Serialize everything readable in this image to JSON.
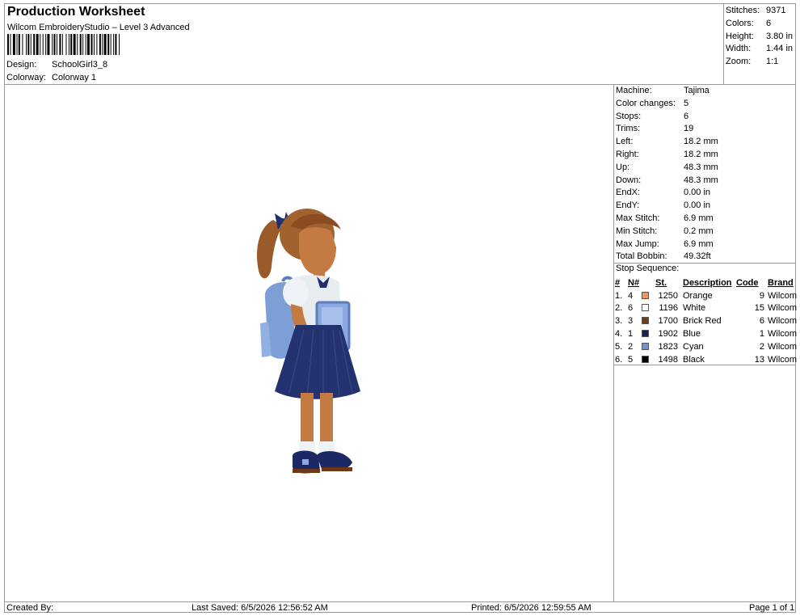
{
  "header": {
    "title": "Production Worksheet",
    "subtitle": "Wilcom EmbroideryStudio – Level 3 Advanced",
    "design_label": "Design:",
    "design_value": "SchoolGirl3_8",
    "colorway_label": "Colorway:",
    "colorway_value": "Colorway 1"
  },
  "summary": [
    {
      "label": "Stitches:",
      "value": "9371"
    },
    {
      "label": "Colors:",
      "value": "6"
    },
    {
      "label": "Height:",
      "value": "3.80 in"
    },
    {
      "label": "Width:",
      "value": "1.44 in"
    },
    {
      "label": "Zoom:",
      "value": "1:1"
    }
  ],
  "machine_info": [
    {
      "label": "Machine:",
      "value": "Tajima"
    },
    {
      "label": "Color changes:",
      "value": "5"
    },
    {
      "label": "Stops:",
      "value": "6"
    },
    {
      "label": "Trims:",
      "value": "19"
    },
    {
      "label": "Left:",
      "value": "18.2 mm"
    },
    {
      "label": "Right:",
      "value": "18.2 mm"
    },
    {
      "label": "Up:",
      "value": "48.3 mm"
    },
    {
      "label": "Down:",
      "value": "48.3 mm"
    },
    {
      "label": "EndX:",
      "value": "0.00 in"
    },
    {
      "label": "EndY:",
      "value": "0.00 in"
    },
    {
      "label": "Max Stitch:",
      "value": "6.9 mm"
    },
    {
      "label": "Min Stitch:",
      "value": "0.2 mm"
    },
    {
      "label": "Max Jump:",
      "value": "6.9 mm"
    },
    {
      "label": "Total Bobbin:",
      "value": "49.32ft"
    }
  ],
  "stop_sequence": {
    "title": "Stop Sequence:",
    "headers": [
      "#",
      "N#",
      "St.",
      "Description",
      "Code",
      "Brand"
    ],
    "rows": [
      {
        "num": "1.",
        "n": "4",
        "st": "1250",
        "desc": "Orange",
        "code": "9",
        "brand": "Wilcom",
        "color": "#f2935c"
      },
      {
        "num": "2.",
        "n": "6",
        "st": "1196",
        "desc": "White",
        "code": "15",
        "brand": "Wilcom",
        "color": "#ffffff"
      },
      {
        "num": "3.",
        "n": "3",
        "st": "1700",
        "desc": "Brick Red",
        "code": "6",
        "brand": "Wilcom",
        "color": "#7a3a12"
      },
      {
        "num": "4.",
        "n": "1",
        "st": "1902",
        "desc": "Blue",
        "code": "1",
        "brand": "Wilcom",
        "color": "#141f5c"
      },
      {
        "num": "5.",
        "n": "2",
        "st": "1823",
        "desc": "Cyan",
        "code": "2",
        "brand": "Wilcom",
        "color": "#6f93d8"
      },
      {
        "num": "6.",
        "n": "5",
        "st": "1498",
        "desc": "Black",
        "code": "13",
        "brand": "Wilcom",
        "color": "#000000"
      }
    ]
  },
  "footer": {
    "created_by": "Created By:",
    "last_saved": "Last Saved: 6/5/2026 12:56:52 AM",
    "printed": "Printed: 6/5/2026 12:59:55 AM",
    "page": "Page 1 of 1"
  }
}
